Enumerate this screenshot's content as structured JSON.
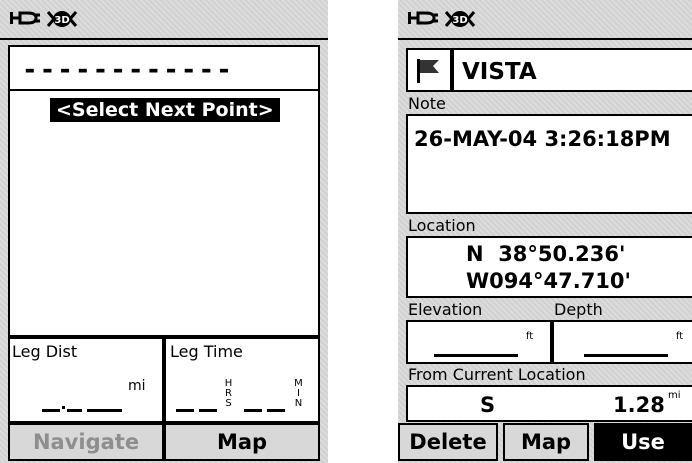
{
  "status": {
    "battery_icon": "battery-icon",
    "gps_icon": "gps-3d-fix-icon",
    "gps_mode": "3D"
  },
  "route": {
    "name_value": "------------",
    "select_label": "<Select Next Point>",
    "leg_dist": {
      "label": "Leg Dist",
      "value": "_ ._ _",
      "unit": "mi"
    },
    "leg_time": {
      "label": "Leg Time",
      "hours": "_ _",
      "minutes": "_ _",
      "hour_unit": "HRS",
      "minute_unit": "MIN"
    },
    "buttons": {
      "navigate": "Navigate",
      "map": "Map"
    }
  },
  "waypoint": {
    "symbol_icon": "flag-icon",
    "name": "VISTA",
    "note_label": "Note",
    "note_value": "26-MAY-04 3:26:18PM",
    "location_label": "Location",
    "lat": "N  38°50.236'",
    "lon": "W094°47.710'",
    "elevation_label": "Elevation",
    "elevation_value": "_____",
    "elevation_unit": "ft",
    "depth_label": "Depth",
    "depth_value": "_____",
    "depth_unit": "ft",
    "from_label": "From Current Location",
    "bearing": "S",
    "distance": "1.28",
    "distance_unit": "mi",
    "buttons": {
      "delete": "Delete",
      "map": "Map",
      "use": "Use"
    }
  }
}
